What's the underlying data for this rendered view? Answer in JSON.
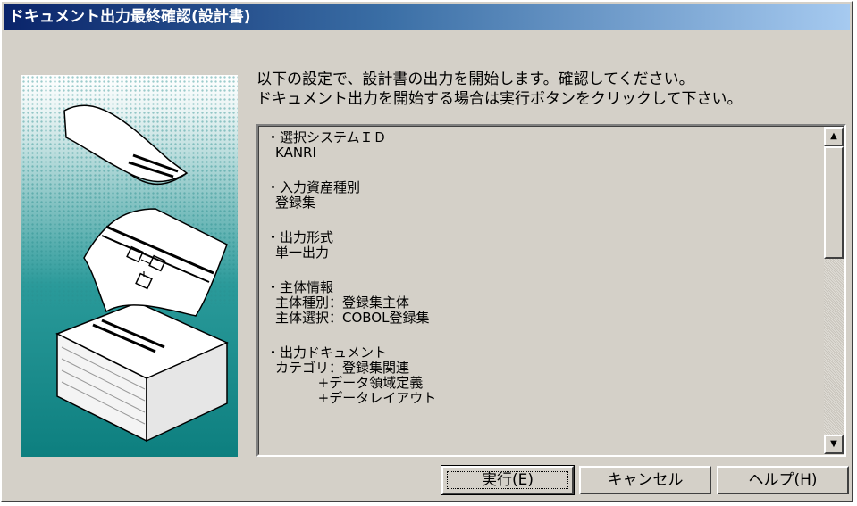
{
  "window": {
    "title": "ドキュメント出力最終確認(設計書)"
  },
  "message": {
    "line1": "以下の設定で、設計書の出力を開始します。確認してください。",
    "line2": "ドキュメント出力を開始する場合は実行ボタンをクリックして下さい。"
  },
  "settings": [
    {
      "title": "・選択システムＩＤ",
      "lines": [
        "KANRI"
      ]
    },
    {
      "title": "・入力資産種別",
      "lines": [
        "登録集"
      ]
    },
    {
      "title": "・出力形式",
      "lines": [
        "単一出力"
      ]
    },
    {
      "title": "・主体情報",
      "lines": [
        "主体種別：登録集主体",
        "主体選択：COBOL登録集"
      ]
    },
    {
      "title": "・出力ドキュメント",
      "lines": [
        "カテゴリ：登録集関連",
        "          +データ領域定義",
        "          +データレイアウト"
      ]
    }
  ],
  "buttons": {
    "execute": "実行(E)",
    "cancel": "キャンセル",
    "help": "ヘルプ(H)"
  }
}
